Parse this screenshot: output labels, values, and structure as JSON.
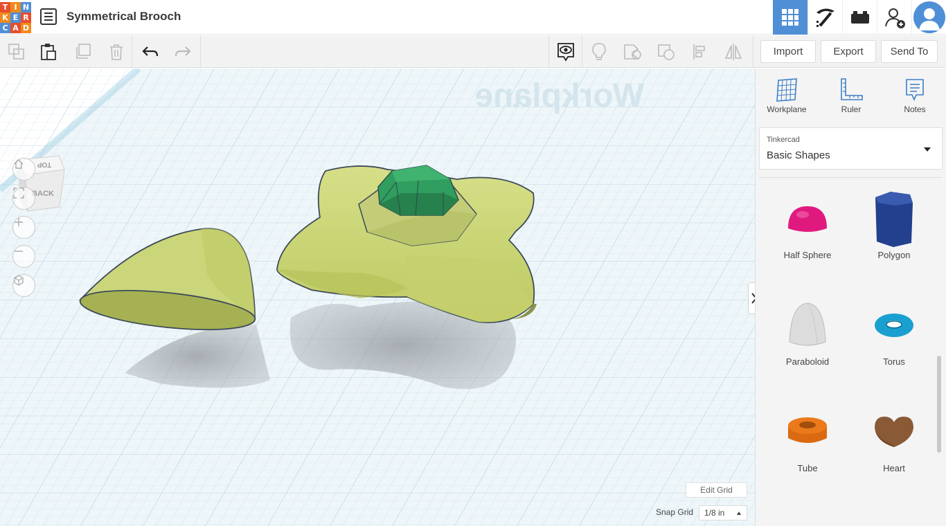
{
  "app": {
    "logo_letters": [
      "T",
      "I",
      "N",
      "K",
      "E",
      "R",
      "C",
      "A",
      "D"
    ],
    "logo_colors": [
      "#e84d2d",
      "#f08a1c",
      "#4f8fd6",
      "#f08a1c",
      "#4f8fd6",
      "#e84d2d",
      "#4f8fd6",
      "#e84d2d",
      "#f08a1c"
    ],
    "project_title": "Symmetrical Brooch",
    "accent_color": "#4f8fd6"
  },
  "top_nav": {
    "icons": [
      "3d-view-grid-icon",
      "build-pickaxe-icon",
      "bricks-icon",
      "invite-user-icon",
      "user-avatar"
    ]
  },
  "toolbar": {
    "import_label": "Import",
    "export_label": "Export",
    "sendto_label": "Send To"
  },
  "workplane": {
    "watermark": "Workplane",
    "viewcube": {
      "top": "TOP",
      "back": "BACK"
    },
    "edit_grid_label": "Edit Grid",
    "snap_grid_label": "Snap Grid",
    "snap_grid_value": "1/8 in"
  },
  "panel": {
    "tools": [
      {
        "label": "Workplane",
        "icon": "workplane-icon"
      },
      {
        "label": "Ruler",
        "icon": "ruler-icon"
      },
      {
        "label": "Notes",
        "icon": "notes-icon"
      }
    ],
    "library_category": "Tinkercad",
    "library_name": "Basic Shapes",
    "shapes": [
      {
        "label": "Half Sphere",
        "color": "#e0197f"
      },
      {
        "label": "Polygon",
        "color": "#23408e"
      },
      {
        "label": "Paraboloid",
        "color": "#dcdcdc"
      },
      {
        "label": "Torus",
        "color": "#1aa0d0"
      },
      {
        "label": "Tube",
        "color": "#ec7a1b"
      },
      {
        "label": "Heart",
        "color": "#8a5a36"
      }
    ]
  }
}
